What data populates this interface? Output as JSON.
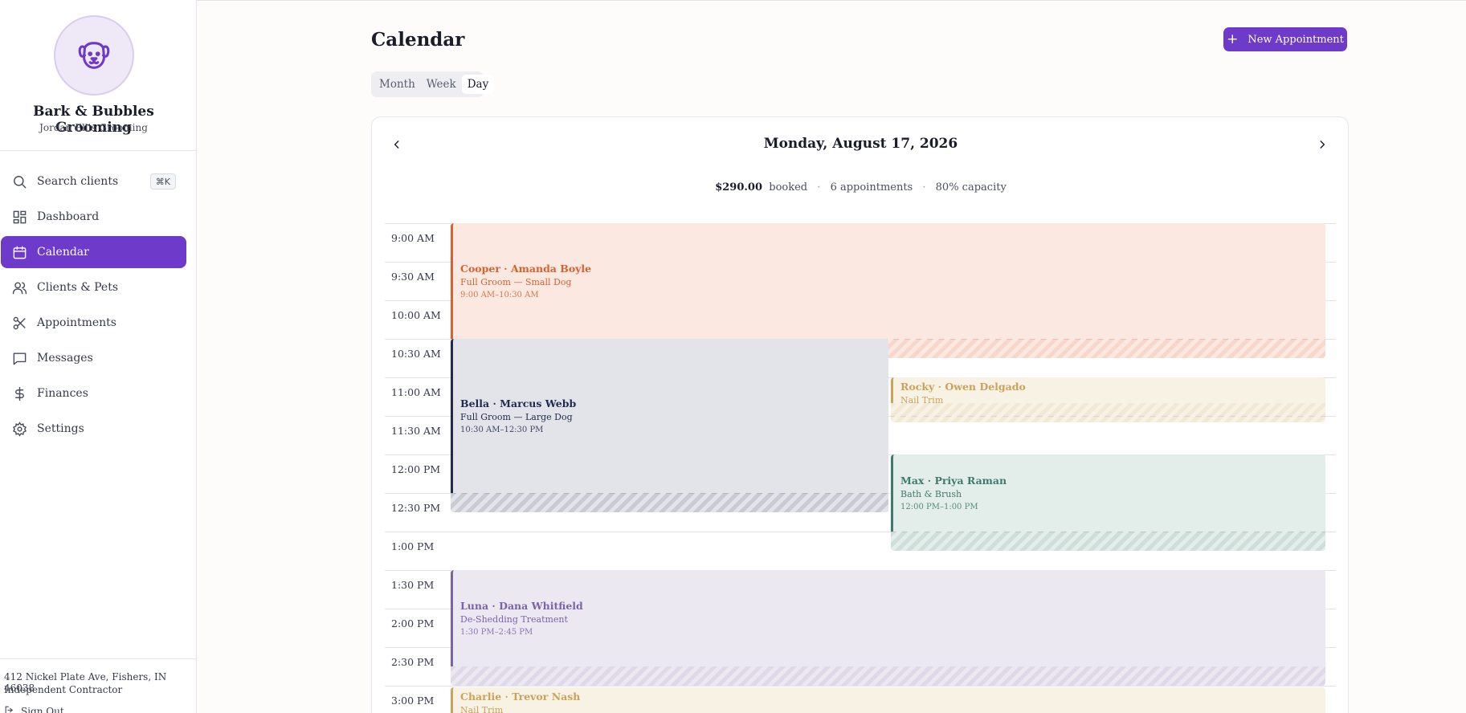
{
  "brand": {
    "name": "Bark & Bubbles Grooming",
    "subtitle": "Jordan Ellis Grooming",
    "logo_icon": "dog-face-icon"
  },
  "sidebar": {
    "search": {
      "label": "Search clients",
      "shortcut": "⌘K",
      "icon": "search-icon"
    },
    "items": [
      {
        "label": "Dashboard",
        "icon": "dashboard-icon",
        "active": false
      },
      {
        "label": "Calendar",
        "icon": "calendar-icon",
        "active": true
      },
      {
        "label": "Clients & Pets",
        "icon": "users-icon",
        "active": false
      },
      {
        "label": "Appointments",
        "icon": "scissors-icon",
        "active": false
      },
      {
        "label": "Messages",
        "icon": "message-icon",
        "active": false
      },
      {
        "label": "Finances",
        "icon": "dollar-icon",
        "active": false
      },
      {
        "label": "Settings",
        "icon": "gear-icon",
        "active": false
      }
    ],
    "footer": {
      "address": "412 Nickel Plate Ave, Fishers, IN 46038",
      "role": "Independent Contractor",
      "signout": "Sign Out"
    }
  },
  "header": {
    "title": "Calendar",
    "new_button": "New Appointment",
    "views": [
      "Month",
      "Week",
      "Day"
    ],
    "active_view": "Day"
  },
  "calendar": {
    "date": "Monday, August 17, 2026",
    "summary": {
      "amount": "$290.00",
      "amount_label": "booked",
      "appointments": "6 appointments",
      "capacity": "80% capacity"
    },
    "time_labels": [
      "9:00 AM",
      "9:30 AM",
      "10:00 AM",
      "10:30 AM",
      "11:00 AM",
      "11:30 AM",
      "12:00 PM",
      "12:30 PM",
      "1:00 PM",
      "1:30 PM",
      "2:00 PM",
      "2:30 PM",
      "3:00 PM"
    ],
    "appointments": [
      {
        "pet": "Cooper · Amanda Boyle",
        "service": "Full Groom — Small Dog",
        "time": "9:00 AM–10:30 AM",
        "color": "#d9612f",
        "bg": "#fbe9e1"
      },
      {
        "pet": "Bella · Marcus Webb",
        "service": "Full Groom — Large Dog",
        "time": "10:30 AM–12:30 PM",
        "color": "#232a52",
        "bg": "#e2e4ea"
      },
      {
        "pet": "Rocky · Owen Delgado",
        "service": "Nail Trim",
        "time": "",
        "color": "#c9a35a",
        "bg": "#f8f2e4"
      },
      {
        "pet": "Max · Priya Raman",
        "service": "Bath & Brush",
        "time": "12:00 PM–1:00 PM",
        "color": "#3f7a6c",
        "bg": "#e3ede9"
      },
      {
        "pet": "Luna · Dana Whitfield",
        "service": "De-Shedding Treatment",
        "time": "1:30 PM–2:45 PM",
        "color": "#7a63a8",
        "bg": "#ece8f2"
      },
      {
        "pet": "Charlie · Trevor Nash",
        "service": "Nail Trim",
        "time": "",
        "color": "#c9a35a",
        "bg": "#f8f2e4"
      }
    ]
  }
}
